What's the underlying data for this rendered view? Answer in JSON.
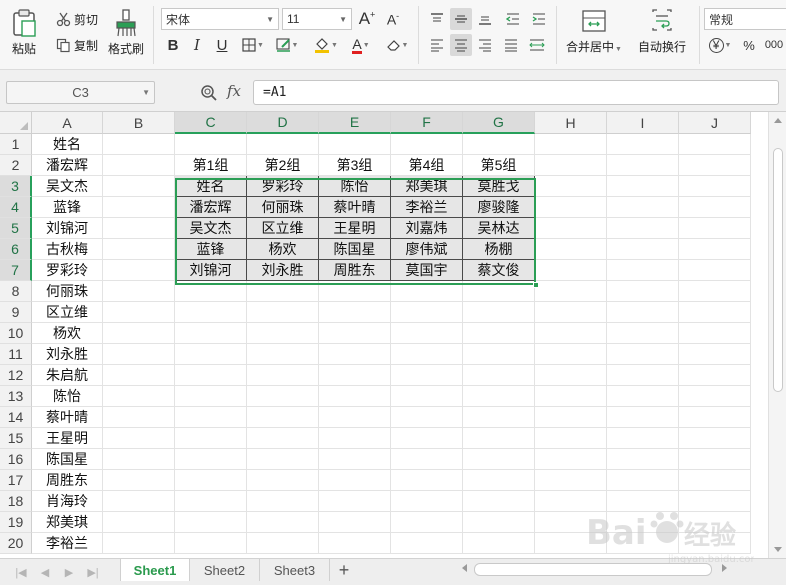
{
  "ribbon": {
    "paste_label": "粘贴",
    "cut_label": "剪切",
    "copy_label": "复制",
    "format_painter_label": "格式刷",
    "font_name": "宋体",
    "font_size": "11",
    "merge_center_label": "合并居中",
    "wrap_text_label": "自动换行",
    "number_format": "常规",
    "percent_symbol": "%",
    "decimal_symbol": "000"
  },
  "formula_bar": {
    "name_box": "C3",
    "fx_label": "fx",
    "formula": "=A1"
  },
  "columns": [
    "A",
    "B",
    "C",
    "D",
    "E",
    "F",
    "G",
    "H",
    "I",
    "J"
  ],
  "rows": [
    "1",
    "2",
    "3",
    "4",
    "5",
    "6",
    "7",
    "8",
    "9",
    "10",
    "11",
    "12",
    "13",
    "14",
    "15",
    "16",
    "17",
    "18",
    "19",
    "20"
  ],
  "column_a": [
    "姓名",
    "潘宏辉",
    "吴文杰",
    "蓝锋",
    "刘锦河",
    "古秋梅",
    "罗彩玲",
    "何丽珠",
    "区立维",
    "杨欢",
    "刘永胜",
    "朱启航",
    "陈怡",
    "蔡叶晴",
    "王星明",
    "陈国星",
    "周胜东",
    "肖海玲",
    "郑美琪",
    "李裕兰"
  ],
  "group_headers": [
    "第1组",
    "第2组",
    "第3组",
    "第4组",
    "第5组"
  ],
  "group_table": [
    [
      "姓名",
      "罗彩玲",
      "陈怡",
      "郑美琪",
      "莫胜戈"
    ],
    [
      "潘宏辉",
      "何丽珠",
      "蔡叶晴",
      "李裕兰",
      "廖骏隆"
    ],
    [
      "吴文杰",
      "区立维",
      "王星明",
      "刘嘉炜",
      "吴林达"
    ],
    [
      "蓝锋",
      "杨欢",
      "陈国星",
      "廖伟斌",
      "杨棚"
    ],
    [
      "刘锦河",
      "刘永胜",
      "周胜东",
      "莫国宇",
      "蔡文俊"
    ]
  ],
  "sheets": [
    "Sheet1",
    "Sheet2",
    "Sheet3"
  ],
  "active_sheet": "Sheet1",
  "colors": {
    "accent_green": "#2b9e55",
    "group_fill": "#e6e6e6"
  }
}
